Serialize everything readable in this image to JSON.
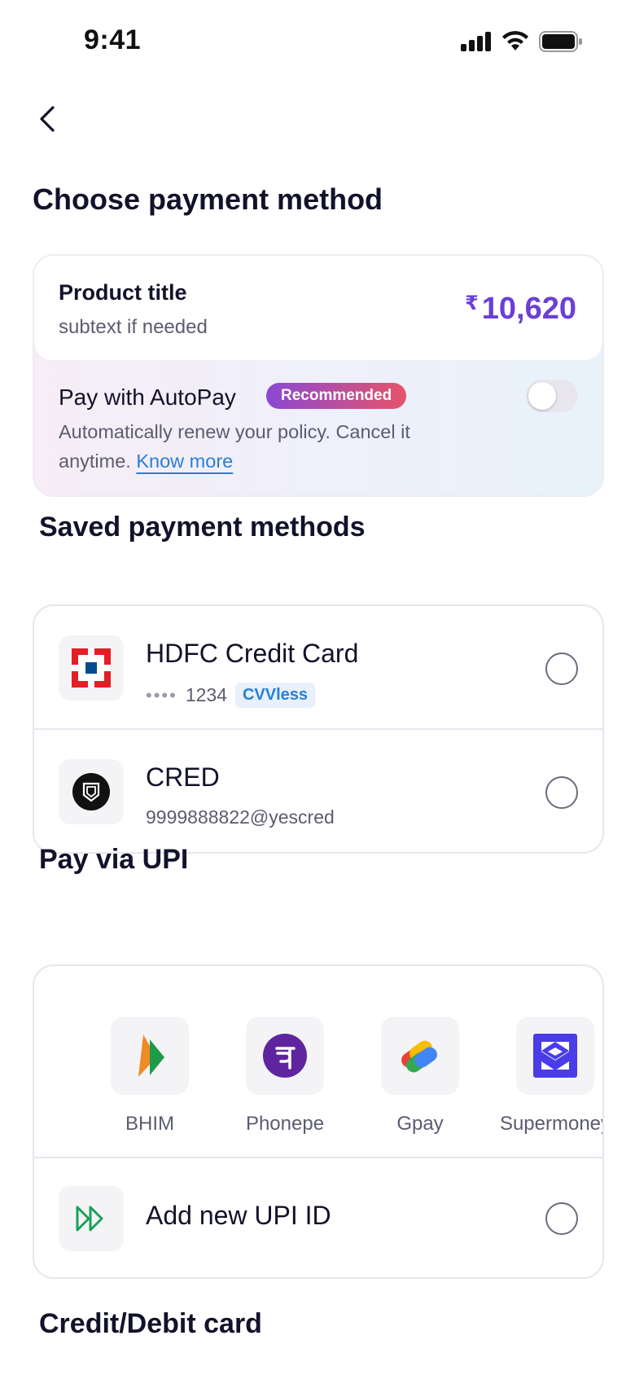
{
  "status": {
    "time": "9:41"
  },
  "page": {
    "title": "Choose payment method"
  },
  "product": {
    "title": "Product title",
    "subtext": "subtext if needed",
    "currency_symbol": "₹",
    "price": "10,620"
  },
  "autopay": {
    "title": "Pay with AutoPay",
    "badge": "Recommended",
    "description": "Automatically renew your policy. Cancel it anytime.",
    "link": "Know more",
    "enabled": false
  },
  "saved": {
    "title": "Saved payment methods",
    "items": [
      {
        "name": "HDFC Credit Card",
        "masked": "••••",
        "last4": "1234",
        "tag": "CVVless",
        "icon": "hdfc-logo-icon"
      },
      {
        "name": "CRED",
        "detail": "9999888822@yescred",
        "icon": "cred-logo-icon"
      }
    ]
  },
  "upi": {
    "title": "Pay via UPI",
    "apps": [
      {
        "label": "BHIM",
        "icon": "bhim-logo-icon"
      },
      {
        "label": "Phonepe",
        "icon": "phonepe-logo-icon"
      },
      {
        "label": "Gpay",
        "icon": "gpay-logo-icon"
      },
      {
        "label": "Supermoney",
        "icon": "supermoney-logo-icon"
      }
    ],
    "add_label": "Add new UPI ID"
  },
  "card": {
    "title": "Credit/Debit card"
  },
  "colors": {
    "accent": "#6a3fd6",
    "link": "#2a7ed6",
    "hdfc_red": "#e31e24",
    "hdfc_blue": "#004c8f"
  }
}
